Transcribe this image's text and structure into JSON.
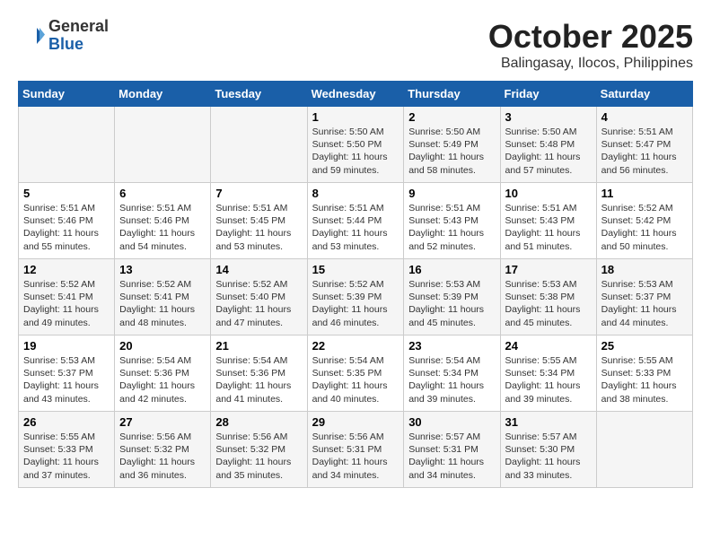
{
  "logo": {
    "general": "General",
    "blue": "Blue"
  },
  "header": {
    "month": "October 2025",
    "location": "Balingasay, Ilocos, Philippines"
  },
  "weekdays": [
    "Sunday",
    "Monday",
    "Tuesday",
    "Wednesday",
    "Thursday",
    "Friday",
    "Saturday"
  ],
  "weeks": [
    [
      {
        "day": "",
        "info": ""
      },
      {
        "day": "",
        "info": ""
      },
      {
        "day": "",
        "info": ""
      },
      {
        "day": "1",
        "info": "Sunrise: 5:50 AM\nSunset: 5:50 PM\nDaylight: 11 hours\nand 59 minutes."
      },
      {
        "day": "2",
        "info": "Sunrise: 5:50 AM\nSunset: 5:49 PM\nDaylight: 11 hours\nand 58 minutes."
      },
      {
        "day": "3",
        "info": "Sunrise: 5:50 AM\nSunset: 5:48 PM\nDaylight: 11 hours\nand 57 minutes."
      },
      {
        "day": "4",
        "info": "Sunrise: 5:51 AM\nSunset: 5:47 PM\nDaylight: 11 hours\nand 56 minutes."
      }
    ],
    [
      {
        "day": "5",
        "info": "Sunrise: 5:51 AM\nSunset: 5:46 PM\nDaylight: 11 hours\nand 55 minutes."
      },
      {
        "day": "6",
        "info": "Sunrise: 5:51 AM\nSunset: 5:46 PM\nDaylight: 11 hours\nand 54 minutes."
      },
      {
        "day": "7",
        "info": "Sunrise: 5:51 AM\nSunset: 5:45 PM\nDaylight: 11 hours\nand 53 minutes."
      },
      {
        "day": "8",
        "info": "Sunrise: 5:51 AM\nSunset: 5:44 PM\nDaylight: 11 hours\nand 53 minutes."
      },
      {
        "day": "9",
        "info": "Sunrise: 5:51 AM\nSunset: 5:43 PM\nDaylight: 11 hours\nand 52 minutes."
      },
      {
        "day": "10",
        "info": "Sunrise: 5:51 AM\nSunset: 5:43 PM\nDaylight: 11 hours\nand 51 minutes."
      },
      {
        "day": "11",
        "info": "Sunrise: 5:52 AM\nSunset: 5:42 PM\nDaylight: 11 hours\nand 50 minutes."
      }
    ],
    [
      {
        "day": "12",
        "info": "Sunrise: 5:52 AM\nSunset: 5:41 PM\nDaylight: 11 hours\nand 49 minutes."
      },
      {
        "day": "13",
        "info": "Sunrise: 5:52 AM\nSunset: 5:41 PM\nDaylight: 11 hours\nand 48 minutes."
      },
      {
        "day": "14",
        "info": "Sunrise: 5:52 AM\nSunset: 5:40 PM\nDaylight: 11 hours\nand 47 minutes."
      },
      {
        "day": "15",
        "info": "Sunrise: 5:52 AM\nSunset: 5:39 PM\nDaylight: 11 hours\nand 46 minutes."
      },
      {
        "day": "16",
        "info": "Sunrise: 5:53 AM\nSunset: 5:39 PM\nDaylight: 11 hours\nand 45 minutes."
      },
      {
        "day": "17",
        "info": "Sunrise: 5:53 AM\nSunset: 5:38 PM\nDaylight: 11 hours\nand 45 minutes."
      },
      {
        "day": "18",
        "info": "Sunrise: 5:53 AM\nSunset: 5:37 PM\nDaylight: 11 hours\nand 44 minutes."
      }
    ],
    [
      {
        "day": "19",
        "info": "Sunrise: 5:53 AM\nSunset: 5:37 PM\nDaylight: 11 hours\nand 43 minutes."
      },
      {
        "day": "20",
        "info": "Sunrise: 5:54 AM\nSunset: 5:36 PM\nDaylight: 11 hours\nand 42 minutes."
      },
      {
        "day": "21",
        "info": "Sunrise: 5:54 AM\nSunset: 5:36 PM\nDaylight: 11 hours\nand 41 minutes."
      },
      {
        "day": "22",
        "info": "Sunrise: 5:54 AM\nSunset: 5:35 PM\nDaylight: 11 hours\nand 40 minutes."
      },
      {
        "day": "23",
        "info": "Sunrise: 5:54 AM\nSunset: 5:34 PM\nDaylight: 11 hours\nand 39 minutes."
      },
      {
        "day": "24",
        "info": "Sunrise: 5:55 AM\nSunset: 5:34 PM\nDaylight: 11 hours\nand 39 minutes."
      },
      {
        "day": "25",
        "info": "Sunrise: 5:55 AM\nSunset: 5:33 PM\nDaylight: 11 hours\nand 38 minutes."
      }
    ],
    [
      {
        "day": "26",
        "info": "Sunrise: 5:55 AM\nSunset: 5:33 PM\nDaylight: 11 hours\nand 37 minutes."
      },
      {
        "day": "27",
        "info": "Sunrise: 5:56 AM\nSunset: 5:32 PM\nDaylight: 11 hours\nand 36 minutes."
      },
      {
        "day": "28",
        "info": "Sunrise: 5:56 AM\nSunset: 5:32 PM\nDaylight: 11 hours\nand 35 minutes."
      },
      {
        "day": "29",
        "info": "Sunrise: 5:56 AM\nSunset: 5:31 PM\nDaylight: 11 hours\nand 34 minutes."
      },
      {
        "day": "30",
        "info": "Sunrise: 5:57 AM\nSunset: 5:31 PM\nDaylight: 11 hours\nand 34 minutes."
      },
      {
        "day": "31",
        "info": "Sunrise: 5:57 AM\nSunset: 5:30 PM\nDaylight: 11 hours\nand 33 minutes."
      },
      {
        "day": "",
        "info": ""
      }
    ]
  ]
}
